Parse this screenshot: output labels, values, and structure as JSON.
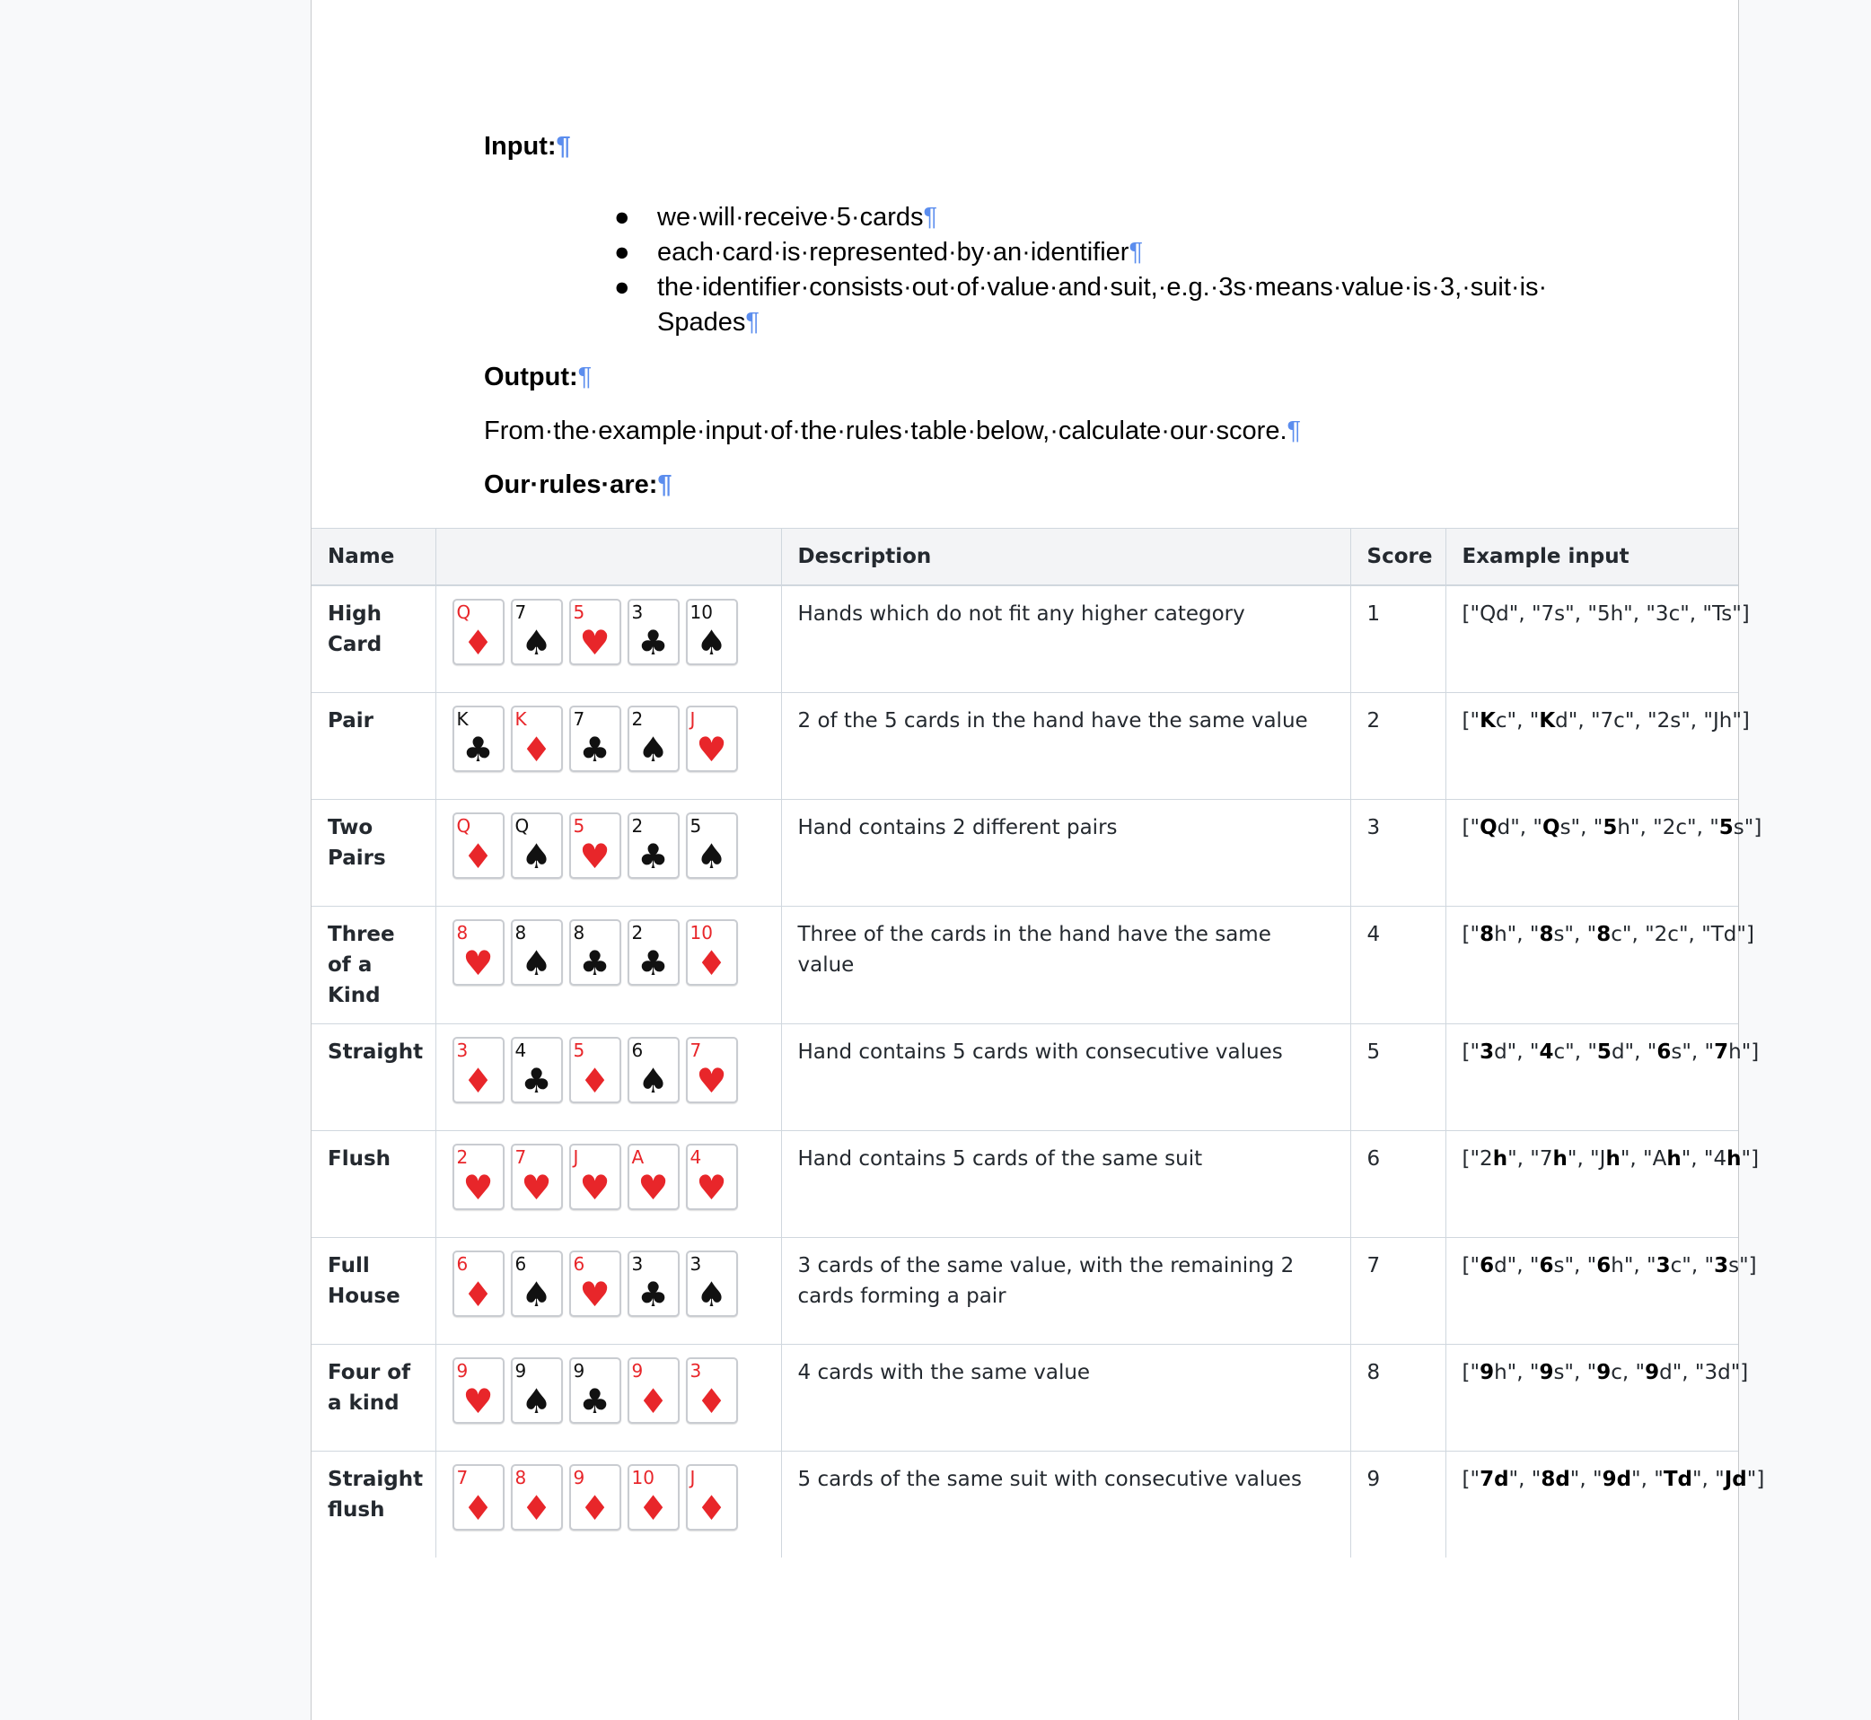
{
  "doc": {
    "input_label": "Input:",
    "bullets": [
      "we·will·receive·5·cards",
      "each·card·is·represented·by·an·identifier",
      "the·identifier·consists·out·of·value·and·suit,·e.g.·3s·means·value·is·3,·suit·is· Spades"
    ],
    "output_label": "Output:",
    "from_text": "From·the·example·input·of·the·rules·table·below,·calculate·our·score.",
    "rules_label": "Our·rules·are:",
    "pilcrow": "¶"
  },
  "table": {
    "headers": [
      "Name",
      "",
      "Description",
      "Score",
      "Example input"
    ],
    "rows": [
      {
        "name": "High Card",
        "cards": [
          [
            "Q",
            "d"
          ],
          [
            "7",
            "s"
          ],
          [
            "5",
            "h"
          ],
          [
            "3",
            "c"
          ],
          [
            "10",
            "s"
          ]
        ],
        "description": "Hands which do not fit any higher category",
        "score": "1",
        "example": [
          [
            "[\"",
            false
          ],
          [
            "Qd\", \"7s\", \"5h\", \"3c\", \"Ts\"]",
            false
          ]
        ]
      },
      {
        "name": "Pair",
        "cards": [
          [
            "K",
            "c"
          ],
          [
            "K",
            "d"
          ],
          [
            "7",
            "c"
          ],
          [
            "2",
            "s"
          ],
          [
            "J",
            "h"
          ]
        ],
        "description": "2 of the 5 cards in the hand have the same value",
        "score": "2",
        "example": [
          [
            "[\"",
            false
          ],
          [
            "K",
            true
          ],
          [
            "c\", \"",
            false
          ],
          [
            "K",
            true
          ],
          [
            "d\", \"7c\", \"2s\", \"Jh\"]",
            false
          ]
        ]
      },
      {
        "name": "Two Pairs",
        "cards": [
          [
            "Q",
            "d"
          ],
          [
            "Q",
            "s"
          ],
          [
            "5",
            "h"
          ],
          [
            "2",
            "c"
          ],
          [
            "5",
            "s"
          ]
        ],
        "description": "Hand contains 2 different pairs",
        "score": "3",
        "example": [
          [
            "[\"",
            false
          ],
          [
            "Q",
            true
          ],
          [
            "d\", \"",
            false
          ],
          [
            "Q",
            true
          ],
          [
            "s\", \"",
            false
          ],
          [
            "5",
            true
          ],
          [
            "h\", \"2c\", \"",
            false
          ],
          [
            "5",
            true
          ],
          [
            "s\"]",
            false
          ]
        ]
      },
      {
        "name": "Three of a Kind",
        "cards": [
          [
            "8",
            "h"
          ],
          [
            "8",
            "s"
          ],
          [
            "8",
            "c"
          ],
          [
            "2",
            "c"
          ],
          [
            "10",
            "d"
          ]
        ],
        "description": "Three of the cards in the hand have the same value",
        "score": "4",
        "example": [
          [
            "[\"",
            false
          ],
          [
            "8",
            true
          ],
          [
            "h\", \"",
            false
          ],
          [
            "8",
            true
          ],
          [
            "s\", \"",
            false
          ],
          [
            "8",
            true
          ],
          [
            "c\", \"2c\", \"Td\"]",
            false
          ]
        ]
      },
      {
        "name": "Straight",
        "cards": [
          [
            "3",
            "d"
          ],
          [
            "4",
            "c"
          ],
          [
            "5",
            "d"
          ],
          [
            "6",
            "s"
          ],
          [
            "7",
            "h"
          ]
        ],
        "description": "Hand contains 5 cards with consecutive values",
        "score": "5",
        "example": [
          [
            "[\"",
            false
          ],
          [
            "3",
            true
          ],
          [
            "d\", \"",
            false
          ],
          [
            "4",
            true
          ],
          [
            "c\", \"",
            false
          ],
          [
            "5",
            true
          ],
          [
            "d\", \"",
            false
          ],
          [
            "6",
            true
          ],
          [
            "s\", \"",
            false
          ],
          [
            "7",
            true
          ],
          [
            "h\"]",
            false
          ]
        ]
      },
      {
        "name": "Flush",
        "cards": [
          [
            "2",
            "h"
          ],
          [
            "7",
            "h"
          ],
          [
            "J",
            "h"
          ],
          [
            "A",
            "h"
          ],
          [
            "4",
            "h"
          ]
        ],
        "description": "Hand contains 5 cards of the same suit",
        "score": "6",
        "example": [
          [
            "[\"2",
            false
          ],
          [
            "h",
            true
          ],
          [
            "\", \"7",
            false
          ],
          [
            "h",
            true
          ],
          [
            "\", \"J",
            false
          ],
          [
            "h",
            true
          ],
          [
            "\", \"A",
            false
          ],
          [
            "h",
            true
          ],
          [
            "\", \"4",
            false
          ],
          [
            "h",
            true
          ],
          [
            "\"]",
            false
          ]
        ]
      },
      {
        "name": "Full House",
        "cards": [
          [
            "6",
            "d"
          ],
          [
            "6",
            "s"
          ],
          [
            "6",
            "h"
          ],
          [
            "3",
            "c"
          ],
          [
            "3",
            "s"
          ]
        ],
        "description": "3 cards of the same value, with the remaining 2 cards forming a pair",
        "score": "7",
        "example": [
          [
            "[\"",
            false
          ],
          [
            "6",
            true
          ],
          [
            "d\", \"",
            false
          ],
          [
            "6",
            true
          ],
          [
            "s\", \"",
            false
          ],
          [
            "6",
            true
          ],
          [
            "h\", \"",
            false
          ],
          [
            "3",
            true
          ],
          [
            "c\", \"",
            false
          ],
          [
            "3",
            true
          ],
          [
            "s\"]",
            false
          ]
        ]
      },
      {
        "name": "Four of a kind",
        "cards": [
          [
            "9",
            "h"
          ],
          [
            "9",
            "s"
          ],
          [
            "9",
            "c"
          ],
          [
            "9",
            "d"
          ],
          [
            "3",
            "d"
          ]
        ],
        "description": "4 cards with the same value",
        "score": "8",
        "example": [
          [
            "[\"",
            false
          ],
          [
            "9",
            true
          ],
          [
            "h\", \"",
            false
          ],
          [
            "9",
            true
          ],
          [
            "s\", \"",
            false
          ],
          [
            "9",
            true
          ],
          [
            "c, \"",
            false
          ],
          [
            "9",
            true
          ],
          [
            "d\", \"3d\"]",
            false
          ]
        ]
      },
      {
        "name": "Straight flush",
        "cards": [
          [
            "7",
            "d"
          ],
          [
            "8",
            "d"
          ],
          [
            "9",
            "d"
          ],
          [
            "10",
            "d"
          ],
          [
            "J",
            "d"
          ]
        ],
        "description": "5 cards of the same suit with consecutive values",
        "score": "9",
        "example": [
          [
            "[\"",
            false
          ],
          [
            "7d",
            true
          ],
          [
            "\", \"",
            false
          ],
          [
            "8d",
            true
          ],
          [
            "\", \"",
            false
          ],
          [
            "9d",
            true
          ],
          [
            "\", \"",
            false
          ],
          [
            "Td",
            true
          ],
          [
            "\", \"",
            false
          ],
          [
            "Jd",
            true
          ],
          [
            "\"]",
            false
          ]
        ]
      }
    ]
  },
  "suits": {
    "h": "♥",
    "d": "♦",
    "c": "♣",
    "s": "♠"
  },
  "colors": {
    "red_suit": "#e8262a",
    "black_suit": "#111111",
    "pilcrow": "#5b8dee",
    "header_bg": "#f3f4f6"
  }
}
